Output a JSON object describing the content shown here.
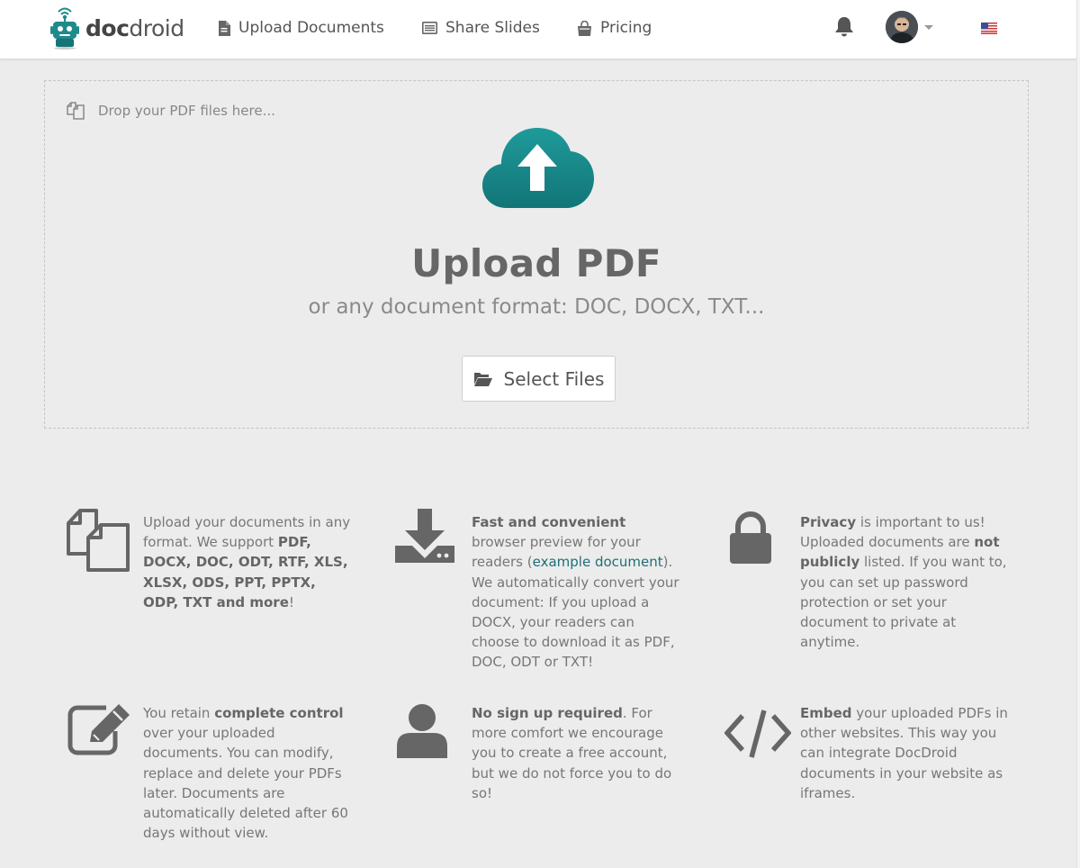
{
  "brand": {
    "name_bold": "doc",
    "name_rest": "droid"
  },
  "nav": {
    "upload": "Upload Documents",
    "slides": "Share Slides",
    "pricing": "Pricing"
  },
  "colors": {
    "accent": "#1f8a8c",
    "accent_dark": "#146d70",
    "text": "#666666",
    "link": "#1f6f78"
  },
  "dropzone": {
    "hint": "Drop your PDF files here...",
    "title": "Upload PDF",
    "subtitle": "or any document format: DOC, DOCX, TXT...",
    "button": "Select Files"
  },
  "features": [
    {
      "icon": "copy-icon",
      "parts": [
        {
          "t": "Upload your documents in any format. We support "
        },
        {
          "t": "PDF, DOCX, DOC, ODT, RTF, XLS, XLSX, ODS, PPT, PPTX, ODP, TXT and more",
          "b": true
        },
        {
          "t": "!"
        }
      ]
    },
    {
      "icon": "download-icon",
      "parts": [
        {
          "t": "Fast and convenient",
          "b": true
        },
        {
          "t": " browser preview for your readers ("
        },
        {
          "t": "example document",
          "a": true
        },
        {
          "t": "). We automatically convert your document: If you upload a DOCX, your readers can choose to download it as PDF, DOC, ODT or TXT!"
        }
      ]
    },
    {
      "icon": "lock-icon",
      "parts": [
        {
          "t": "Privacy",
          "b": true
        },
        {
          "t": " is important to us! Uploaded documents are "
        },
        {
          "t": "not publicly",
          "b": true
        },
        {
          "t": " listed. If you want to, you can set up password protection or set your document to private at anytime."
        }
      ]
    },
    {
      "icon": "edit-icon",
      "parts": [
        {
          "t": "You retain "
        },
        {
          "t": "complete control",
          "b": true
        },
        {
          "t": " over your uploaded documents. You can modify, replace and delete your PDFs later. Documents are automatically deleted after 60 days without view."
        }
      ]
    },
    {
      "icon": "user-icon",
      "parts": [
        {
          "t": "No sign up required",
          "b": true
        },
        {
          "t": ". For more comfort we encourage you to create a free account, but we do not force you to do so!"
        }
      ]
    },
    {
      "icon": "code-icon",
      "parts": [
        {
          "t": "Embed",
          "b": true
        },
        {
          "t": " your uploaded PDFs in other websites. This way you can integrate DocDroid documents in your website as iframes."
        }
      ]
    }
  ]
}
